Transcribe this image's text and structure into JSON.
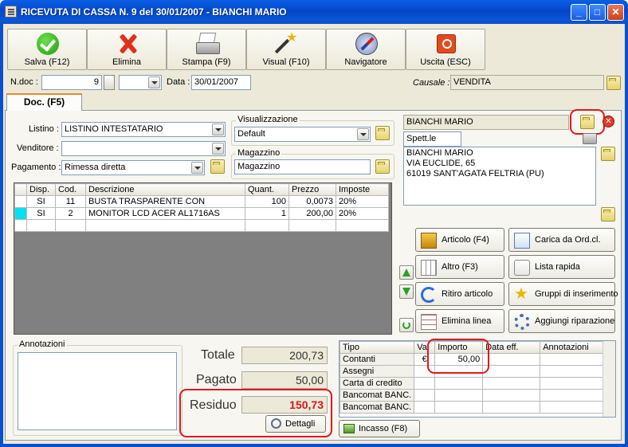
{
  "window": {
    "title": "RICEVUTA DI CASSA N. 9  del 30/01/2007 - BIANCHI MARIO",
    "minimize": "_",
    "maximize": "□",
    "close": "✕"
  },
  "toolbar": [
    {
      "label": "Salva (F12)",
      "icon": "check-icon"
    },
    {
      "label": "Elimina",
      "icon": "delete-icon"
    },
    {
      "label": "Stampa (F9)",
      "icon": "printer-icon"
    },
    {
      "label": "Visual (F10)",
      "icon": "magic-wand-icon"
    },
    {
      "label": "Navigatore",
      "icon": "compass-icon"
    },
    {
      "label": "Uscita (ESC)",
      "icon": "exit-icon"
    }
  ],
  "header": {
    "ndoc_label": "N.doc :",
    "ndoc_value": "9",
    "data_label": "Data :",
    "data_value": "30/01/2007",
    "causale_label": "Causale :",
    "causale_value": "VENDITA"
  },
  "tab": {
    "label": "Doc. (F5)"
  },
  "form": {
    "listino_label": "Listino :",
    "listino_value": "LISTINO INTESTATARIO",
    "venditore_label": "Venditore :",
    "venditore_value": "",
    "pagamento_label": "Pagamento :",
    "pagamento_value": "Rimessa diretta",
    "visualizzazione_label": "Visualizzazione",
    "visualizzazione_value": "Default",
    "magazzino_label": "Magazzino",
    "magazzino_value": "Magazzino"
  },
  "customer": {
    "name": "BIANCHI MARIO",
    "title": "Spett.le",
    "address_lines": [
      "BIANCHI MARIO",
      "VIA EUCLIDE, 65",
      "61019 SANT'AGATA FELTRIA (PU)"
    ]
  },
  "items_table": {
    "columns": [
      "Disp.",
      "Cod.",
      "Descrizione",
      "Quant.",
      "Prezzo",
      "Imposte"
    ],
    "rows": [
      [
        "SI",
        "11",
        "BUSTA TRASPARENTE CON",
        "100",
        "0,0073",
        "20%"
      ],
      [
        "SI",
        "2",
        "MONITOR LCD ACER AL1716AS",
        "1",
        "200,00",
        "20%"
      ]
    ]
  },
  "actions": [
    {
      "label": "Articolo (F4)",
      "icon": "box-add-icon"
    },
    {
      "label": "Carica da Ord.cl.",
      "icon": "load-order-icon"
    },
    {
      "label": "Altro (F3)",
      "icon": "grid-add-icon"
    },
    {
      "label": "Lista rapida",
      "icon": "quick-list-icon"
    },
    {
      "label": "Ritiro articolo",
      "icon": "return-icon"
    },
    {
      "label": "Gruppi di inserimento",
      "icon": "star-icon"
    },
    {
      "label": "Elimina linea",
      "icon": "delete-line-icon"
    },
    {
      "label": "Aggiungi riparazione",
      "icon": "gear-icon"
    }
  ],
  "notes": {
    "label": "Annotazioni"
  },
  "totals": {
    "totale_label": "Totale",
    "totale_value": "200,73",
    "pagato_label": "Pagato",
    "pagato_value": "50,00",
    "residuo_label": "Residuo",
    "residuo_value": "150,73",
    "dettagli_label": "Dettagli"
  },
  "payments": {
    "columns": [
      "Tipo",
      "Val",
      "Importo",
      "Data eff.",
      "Annotazioni"
    ],
    "rows": [
      [
        "Contanti",
        "€",
        "50,00",
        "",
        ""
      ],
      [
        "Assegni",
        "",
        "",
        "",
        ""
      ],
      [
        "Carta di credito",
        "",
        "",
        "",
        ""
      ],
      [
        "Bancomat BANC.",
        "",
        "",
        "",
        ""
      ],
      [
        "Bancomat BANC.",
        "",
        "",
        "",
        ""
      ]
    ],
    "incasso_label": "Incasso (F8)"
  },
  "colors": {
    "highlight_red": "#e6161b",
    "residuo_text": "#d8161b",
    "title_blue": "#0447c8",
    "row_marker": "#00e0f0"
  }
}
